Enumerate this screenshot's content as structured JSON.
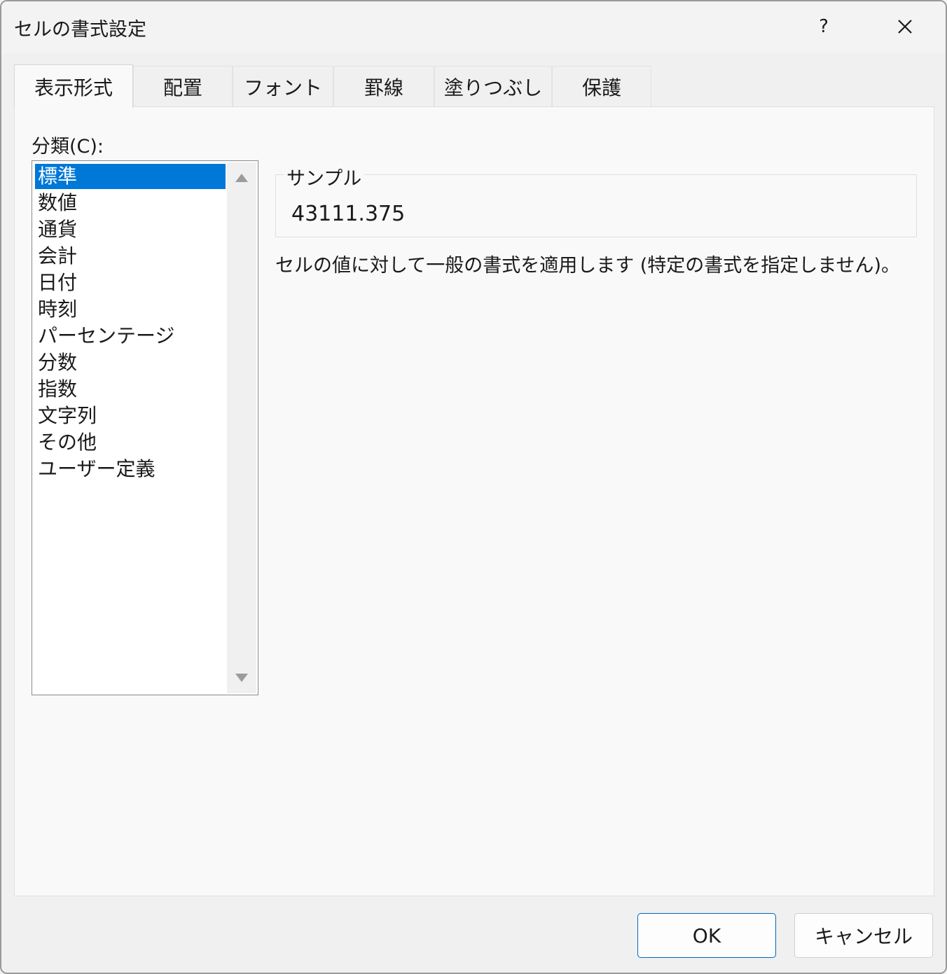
{
  "window": {
    "title": "セルの書式設定",
    "help_label": "?"
  },
  "tabs": [
    {
      "label": "表示形式",
      "active": true
    },
    {
      "label": "配置",
      "active": false
    },
    {
      "label": "フォント",
      "active": false
    },
    {
      "label": "罫線",
      "active": false
    },
    {
      "label": "塗りつぶし",
      "active": false
    },
    {
      "label": "保護",
      "active": false
    }
  ],
  "category": {
    "label": "分類(C):",
    "items": [
      "標準",
      "数値",
      "通貨",
      "会計",
      "日付",
      "時刻",
      "パーセンテージ",
      "分数",
      "指数",
      "文字列",
      "その他",
      "ユーザー定義"
    ],
    "selected": "標準"
  },
  "sample": {
    "legend": "サンプル",
    "value": "43111.375"
  },
  "description": "セルの値に対して一般の書式を適用します (特定の書式を指定しません)。",
  "buttons": {
    "ok": "OK",
    "cancel": "キャンセル"
  },
  "colors": {
    "selection": "#0078d7",
    "primary_border": "#0067c0"
  }
}
